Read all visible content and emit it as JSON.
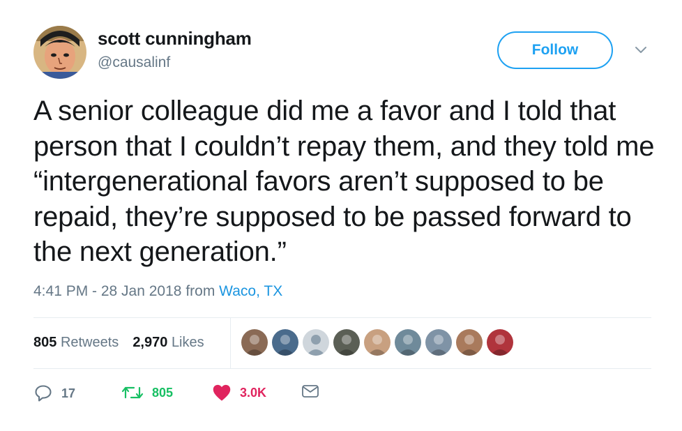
{
  "author": {
    "name": "scott cunningham",
    "handle": "@causalinf",
    "avatar_icon": "comic-portrait-avatar"
  },
  "follow_label": "Follow",
  "menu_icon": "chevron-down-icon",
  "tweet_text": "A senior colleague did me a favor and I told that person that I couldn’t repay them, and they told me “intergenerational favors aren’t supposed to be repaid, they’re supposed to be passed forward to the next generation.”",
  "timestamp": "4:41 PM - 28 Jan 2018",
  "from_label": "from",
  "location": "Waco, TX",
  "stats": {
    "retweets_count": "805",
    "retweets_label": "Retweets",
    "likes_count": "2,970",
    "likes_label": "Likes"
  },
  "likers": [
    {
      "color": "#8a6a55"
    },
    {
      "color": "#4a6b8c"
    },
    {
      "color": "#cfd6dc"
    },
    {
      "color": "#5b5f55"
    },
    {
      "color": "#c8a080"
    },
    {
      "color": "#6f8a9a"
    },
    {
      "color": "#7f93a6"
    },
    {
      "color": "#a97a5c"
    },
    {
      "color": "#b0343c"
    }
  ],
  "actions": {
    "reply_count": "17",
    "retweet_count": "805",
    "like_count": "3.0K"
  },
  "colors": {
    "accent": "#1da1f2",
    "link": "#1b95e0",
    "retweet": "#17bf63",
    "like": "#e0245e",
    "secondary_text": "#657786"
  }
}
